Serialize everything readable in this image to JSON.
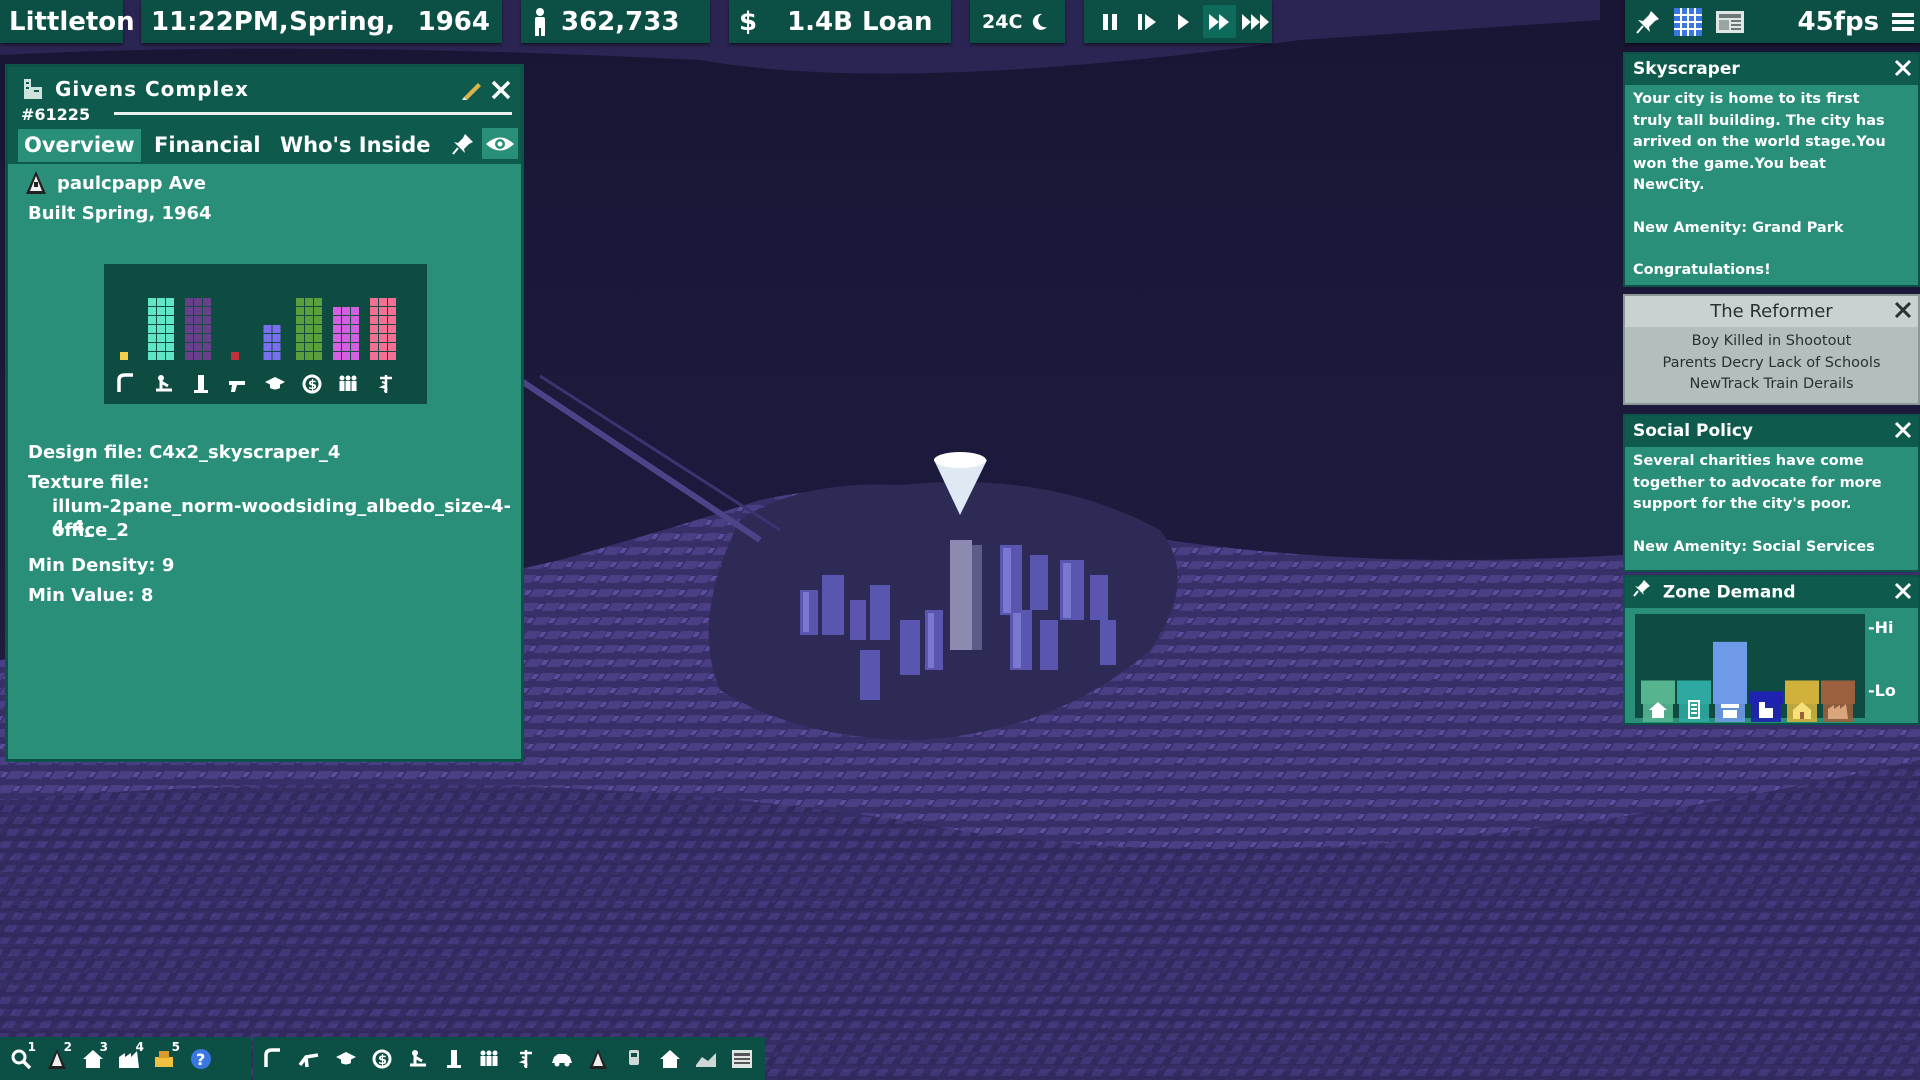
{
  "topbar": {
    "city": "Littleton",
    "time": "11:22PM,",
    "season": "Spring,",
    "year": "1964",
    "population": "362,733",
    "money_symbol": "$",
    "loan": "1.4B Loan",
    "temperature": "24C",
    "fps": "45fps",
    "speed_buttons": [
      "pause-icon",
      "step-icon",
      "play-icon",
      "fast-forward-icon",
      "fastest-icon"
    ],
    "active_speed": "fast-forward-icon"
  },
  "building_panel": {
    "name": "Givens Complex",
    "id": "#61225",
    "tabs": [
      "Overview",
      "Financial",
      "Who's Inside"
    ],
    "selected_tab": "Overview",
    "street": "paulcpapp Ave",
    "built": "Built Spring, 1964",
    "design_file": "Design file: C4x2_skyscraper_4",
    "texture_label": "Texture file:",
    "texture_value_1": "illum-2pane_norm-woodsiding_albedo_size-4-4-4_",
    "texture_value_2": "office_2",
    "min_density": "Min Density: 9",
    "min_value": "Min Value: 8",
    "stats": [
      {
        "icon": "road-icon",
        "color": "#f2d04b",
        "level": 1
      },
      {
        "icon": "park-icon",
        "color": "#5ee6c6",
        "level": 7
      },
      {
        "icon": "skyscraper-icon",
        "color": "#6a3f8a",
        "level": 7
      },
      {
        "icon": "crime-icon",
        "color": "#c0323a",
        "level": 1
      },
      {
        "icon": "education-icon",
        "color": "#7a70ef",
        "level": 4
      },
      {
        "icon": "prosperity-icon",
        "color": "#5a9e3d",
        "level": 7
      },
      {
        "icon": "community-icon",
        "color": "#d55fe0",
        "level": 6
      },
      {
        "icon": "health-icon",
        "color": "#f46f94",
        "level": 7
      }
    ]
  },
  "notifications": {
    "skyscraper": {
      "title": "Skyscraper",
      "lines": [
        "Your city is home to its first",
        "truly tall building. The city has",
        "arrived on the world stage.You",
        "won the game.You beat",
        "NewCity.",
        "",
        "New Amenity: Grand Park",
        "",
        "Congratulations!"
      ]
    },
    "reformer": {
      "title": "The Reformer",
      "headlines": [
        "Boy Killed in Shootout",
        "Parents Decry Lack of Schools",
        "NewTrack Train Derails"
      ]
    },
    "social_policy": {
      "title": "Social Policy",
      "lines": [
        "Several charities have come",
        "together to advocate for more",
        "support for the city's poor.",
        "",
        "New Amenity: Social Services"
      ]
    },
    "zone_demand": {
      "title": "Zone Demand",
      "hi_label": "-Hi",
      "lo_label": "-Lo",
      "zones": [
        {
          "icon": "house-icon",
          "color": "#56b58f",
          "demand": 0.28
        },
        {
          "icon": "apartment-icon",
          "color": "#2ea9a2",
          "demand": 0.28
        },
        {
          "icon": "store-icon",
          "color": "#6f9ae8",
          "demand": 0.74
        },
        {
          "icon": "office-icon",
          "color": "#1f22b0",
          "demand": 0.15
        },
        {
          "icon": "farm-icon",
          "color": "#d0b13c",
          "demand": 0.28
        },
        {
          "icon": "factory-icon",
          "color": "#9b603e",
          "demand": 0.28
        }
      ]
    }
  },
  "bottom_left": [
    {
      "icon": "search-icon",
      "num": "1"
    },
    {
      "icon": "road-cone-icon",
      "num": "2"
    },
    {
      "icon": "house-zone-icon",
      "num": "3"
    },
    {
      "icon": "factory-zone-icon",
      "num": "4"
    },
    {
      "icon": "bulldoze-icon",
      "num": "5"
    },
    {
      "icon": "help-icon",
      "num": ""
    }
  ],
  "bottom_right": [
    "road-icon",
    "freeway-icon",
    "education-icon",
    "prosperity-icon",
    "park-icon",
    "skyscraper-icon",
    "community-icon",
    "health-icon",
    "car-icon",
    "cone-icon",
    "transit-icon",
    "home-icon",
    "heatmap-icon",
    "newspaper-icon"
  ],
  "colors": {
    "panel": "#2a8f79",
    "panel_dark": "#0e5a4c",
    "bar": "#0c4f44",
    "water": "#1d1b3c",
    "land": "#3a3370"
  }
}
